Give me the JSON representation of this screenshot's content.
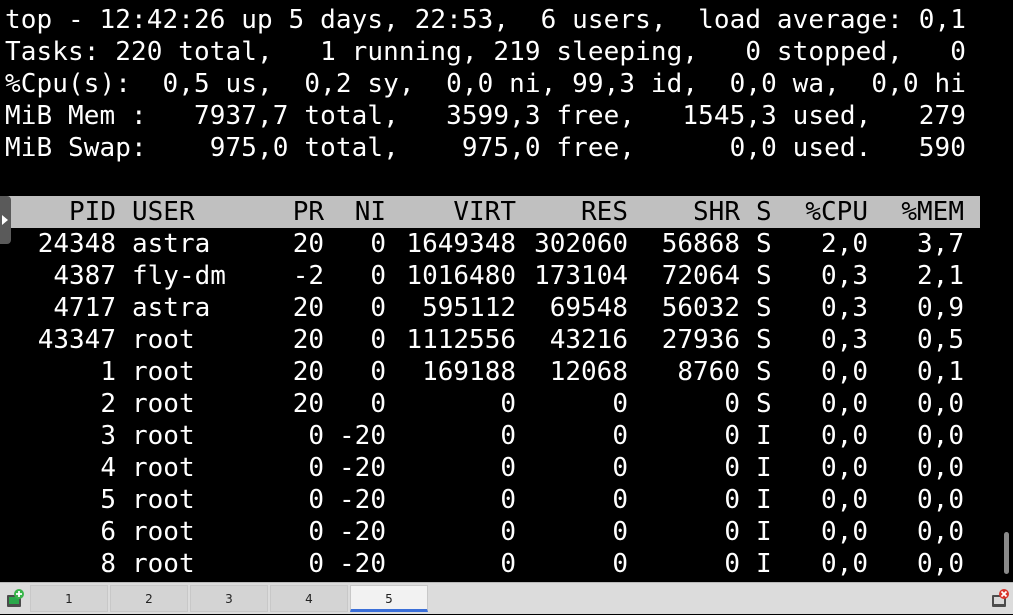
{
  "summary": {
    "line1": "top - 12:42:26 up 5 days, 22:53,  6 users,  load average: 0,1",
    "line2": "Tasks: 220 total,   1 running, 219 sleeping,   0 stopped,   0",
    "line3": "%Cpu(s):  0,5 us,  0,2 sy,  0,0 ni, 99,3 id,  0,0 wa,  0,0 hi",
    "line4": "MiB Mem :   7937,7 total,   3599,3 free,   1545,3 used,   279",
    "line5": "MiB Swap:    975,0 total,    975,0 free,      0,0 used.   590"
  },
  "table": {
    "headers": {
      "pid": "PID",
      "user": "USER",
      "pr": "PR",
      "ni": "NI",
      "virt": "VIRT",
      "res": "RES",
      "shr": "SHR",
      "s": "S",
      "cpu": "%CPU",
      "mem": "%MEM"
    },
    "rows": [
      {
        "pid": "24348",
        "user": "astra",
        "pr": "20",
        "ni": "0",
        "virt": "1649348",
        "res": "302060",
        "shr": "56868",
        "s": "S",
        "cpu": "2,0",
        "mem": "3,7"
      },
      {
        "pid": "4387",
        "user": "fly-dm",
        "pr": "-2",
        "ni": "0",
        "virt": "1016480",
        "res": "173104",
        "shr": "72064",
        "s": "S",
        "cpu": "0,3",
        "mem": "2,1"
      },
      {
        "pid": "4717",
        "user": "astra",
        "pr": "20",
        "ni": "0",
        "virt": "595112",
        "res": "69548",
        "shr": "56032",
        "s": "S",
        "cpu": "0,3",
        "mem": "0,9"
      },
      {
        "pid": "43347",
        "user": "root",
        "pr": "20",
        "ni": "0",
        "virt": "1112556",
        "res": "43216",
        "shr": "27936",
        "s": "S",
        "cpu": "0,3",
        "mem": "0,5"
      },
      {
        "pid": "1",
        "user": "root",
        "pr": "20",
        "ni": "0",
        "virt": "169188",
        "res": "12068",
        "shr": "8760",
        "s": "S",
        "cpu": "0,0",
        "mem": "0,1"
      },
      {
        "pid": "2",
        "user": "root",
        "pr": "20",
        "ni": "0",
        "virt": "0",
        "res": "0",
        "shr": "0",
        "s": "S",
        "cpu": "0,0",
        "mem": "0,0"
      },
      {
        "pid": "3",
        "user": "root",
        "pr": "0",
        "ni": "-20",
        "virt": "0",
        "res": "0",
        "shr": "0",
        "s": "I",
        "cpu": "0,0",
        "mem": "0,0"
      },
      {
        "pid": "4",
        "user": "root",
        "pr": "0",
        "ni": "-20",
        "virt": "0",
        "res": "0",
        "shr": "0",
        "s": "I",
        "cpu": "0,0",
        "mem": "0,0"
      },
      {
        "pid": "5",
        "user": "root",
        "pr": "0",
        "ni": "-20",
        "virt": "0",
        "res": "0",
        "shr": "0",
        "s": "I",
        "cpu": "0,0",
        "mem": "0,0"
      },
      {
        "pid": "6",
        "user": "root",
        "pr": "0",
        "ni": "-20",
        "virt": "0",
        "res": "0",
        "shr": "0",
        "s": "I",
        "cpu": "0,0",
        "mem": "0,0"
      },
      {
        "pid": "8",
        "user": "root",
        "pr": "0",
        "ni": "-20",
        "virt": "0",
        "res": "0",
        "shr": "0",
        "s": "I",
        "cpu": "0,0",
        "mem": "0,0"
      }
    ]
  },
  "taskbar": {
    "tabs": [
      {
        "label": "1",
        "active": false
      },
      {
        "label": "2",
        "active": false
      },
      {
        "label": "3",
        "active": false
      },
      {
        "label": "4",
        "active": false
      },
      {
        "label": "5",
        "active": true
      }
    ],
    "left_icon": "new-terminal-icon",
    "right_icon": "close-terminal-icon"
  },
  "colors": {
    "header_bg": "#c0c0c0",
    "terminal_bg": "#000000",
    "text": "#ffffff",
    "active_tab_accent": "#3b6fd8"
  }
}
